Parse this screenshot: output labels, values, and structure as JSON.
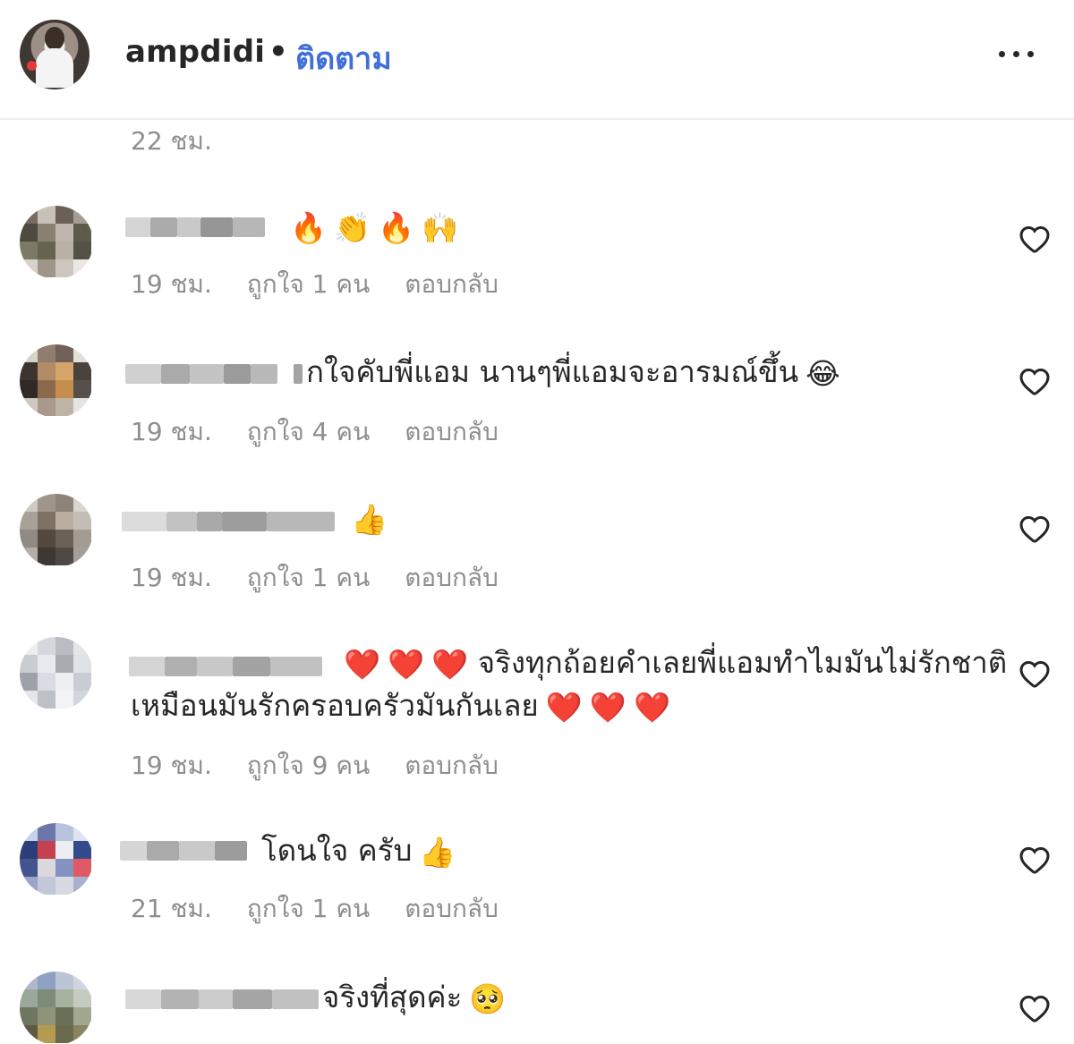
{
  "header": {
    "username": "ampdidi",
    "separator": "•",
    "follow_label": "ติดตาม",
    "more_icon": "more-horizontal-icon"
  },
  "older_comment_time": "22 ชม.",
  "comments": [
    {
      "text": "",
      "emojis": [
        "🔥",
        "👏",
        "🔥",
        "🙌"
      ],
      "time": "19 ชม.",
      "likes": "ถูกใจ 1 คน",
      "reply": "ตอบกลับ"
    },
    {
      "text": "กใจคับพี่แอม นานๆพี่แอมจะอารมณ์ขึ้น",
      "emojis": [
        "😂"
      ],
      "time": "19 ชม.",
      "likes": "ถูกใจ 4 คน",
      "reply": "ตอบกลับ"
    },
    {
      "text": "",
      "emojis": [
        "👍"
      ],
      "time": "19 ชม.",
      "likes": "ถูกใจ 1 คน",
      "reply": "ตอบกลับ"
    },
    {
      "text": "จริงทุกถ้อยคำเลยพี่แอมทำไมมันไม่รักชาติ",
      "emojis": [
        "❤️",
        "❤️",
        "❤️"
      ],
      "text2": "เหมือนมันรักครอบครัวมันกันเลย",
      "emojis2": [
        "❤️",
        "❤️",
        "❤️"
      ],
      "time": "19 ชม.",
      "likes": "ถูกใจ 9 คน",
      "reply": "ตอบกลับ"
    },
    {
      "text": "โดนใจ ครับ",
      "emojis": [
        "👍"
      ],
      "time": "21 ชม.",
      "likes": "ถูกใจ 1 คน",
      "reply": "ตอบกลับ"
    },
    {
      "text": "จริงที่สุดค่ะ",
      "emojis": [
        "🥺"
      ],
      "time": "",
      "likes": "",
      "reply": ""
    }
  ],
  "colors": {
    "text": "#262626",
    "secondary": "#8e8e8e",
    "link": "#3f6fd8",
    "heart": "#e8325a"
  }
}
